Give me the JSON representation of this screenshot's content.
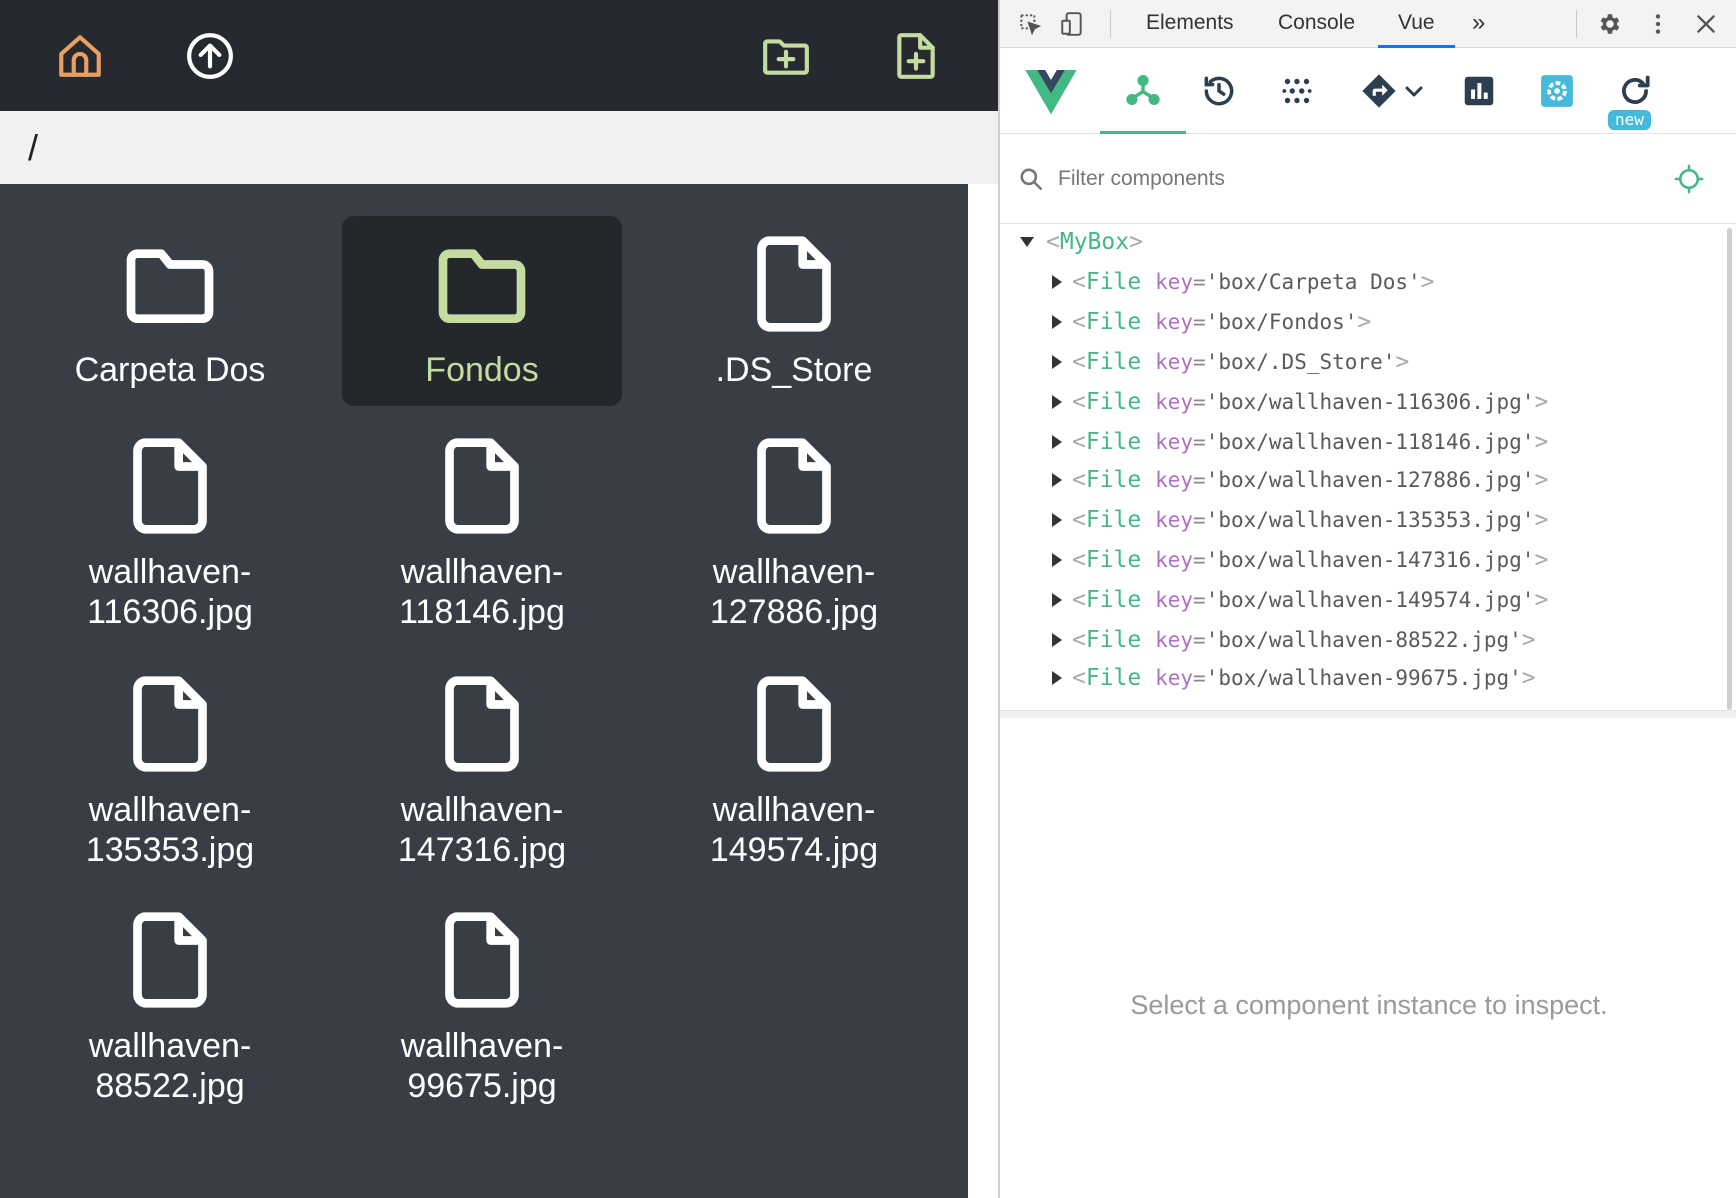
{
  "app": {
    "path": "/",
    "colors": {
      "toolbar_bg": "#262a30",
      "grid_bg": "#393e46",
      "home_icon": "#e8a062",
      "accent_green": "#c5dca0",
      "folder_normal": "#ffffff"
    },
    "toolbar": {
      "home_icon": "home-icon",
      "up_icon": "arrow-up-circle-icon",
      "new_folder_icon": "folder-plus-icon",
      "new_file_icon": "file-plus-icon"
    },
    "items": [
      {
        "name": "Carpeta Dos",
        "line1": "Carpeta Dos",
        "line2": "",
        "type": "folder",
        "selected": false
      },
      {
        "name": "Fondos",
        "line1": "Fondos",
        "line2": "",
        "type": "folder",
        "selected": true
      },
      {
        "name": ".DS_Store",
        "line1": ".DS_Store",
        "line2": "",
        "type": "file",
        "selected": false
      },
      {
        "name": "wallhaven-116306.jpg",
        "line1": "wallhaven-",
        "line2": "116306.jpg",
        "type": "file",
        "selected": false
      },
      {
        "name": "wallhaven-118146.jpg",
        "line1": "wallhaven-",
        "line2": "118146.jpg",
        "type": "file",
        "selected": false
      },
      {
        "name": "wallhaven-127886.jpg",
        "line1": "wallhaven-",
        "line2": "127886.jpg",
        "type": "file",
        "selected": false
      },
      {
        "name": "wallhaven-135353.jpg",
        "line1": "wallhaven-",
        "line2": "135353.jpg",
        "type": "file",
        "selected": false
      },
      {
        "name": "wallhaven-147316.jpg",
        "line1": "wallhaven-",
        "line2": "147316.jpg",
        "type": "file",
        "selected": false
      },
      {
        "name": "wallhaven-149574.jpg",
        "line1": "wallhaven-",
        "line2": "149574.jpg",
        "type": "file",
        "selected": false
      },
      {
        "name": "wallhaven-88522.jpg",
        "line1": "wallhaven-",
        "line2": "88522.jpg",
        "type": "file",
        "selected": false
      },
      {
        "name": "wallhaven-99675.jpg",
        "line1": "wallhaven-",
        "line2": "99675.jpg",
        "type": "file",
        "selected": false
      }
    ]
  },
  "devtools": {
    "tabs": {
      "elements": "Elements",
      "console": "Console",
      "vue": "Vue",
      "more": "»"
    },
    "active_tab": "Vue",
    "icons": {
      "inspect": "inspect-element-icon",
      "device": "device-toolbar-icon",
      "settings": "gear-icon",
      "kebab": "more-vert-icon",
      "close": "close-icon"
    },
    "vue": {
      "logo": "vue-logo-icon",
      "toolbar_icons": [
        "components-icon",
        "timeline-icon",
        "vuex-icon",
        "router-icon",
        "performance-icon",
        "settings-icon",
        "refresh-icon"
      ],
      "new_badge": "new",
      "accent": "#42b883",
      "filter_placeholder": "Filter components",
      "root": {
        "open": "<",
        "tag": "MyBox",
        "close": ">"
      },
      "components": [
        {
          "tag": "File",
          "attr": "key",
          "eq": "=",
          "value": "'box/Carpeta Dos'"
        },
        {
          "tag": "File",
          "attr": "key",
          "eq": "=",
          "value": "'box/Fondos'"
        },
        {
          "tag": "File",
          "attr": "key",
          "eq": "=",
          "value": "'box/.DS_Store'"
        },
        {
          "tag": "File",
          "attr": "key",
          "eq": "=",
          "value": "'box/wallhaven-116306.jpg'"
        },
        {
          "tag": "File",
          "attr": "key",
          "eq": "=",
          "value": "'box/wallhaven-118146.jpg'"
        },
        {
          "tag": "File",
          "attr": "key",
          "eq": "=",
          "value": "'box/wallhaven-127886.jpg'"
        },
        {
          "tag": "File",
          "attr": "key",
          "eq": "=",
          "value": "'box/wallhaven-135353.jpg'"
        },
        {
          "tag": "File",
          "attr": "key",
          "eq": "=",
          "value": "'box/wallhaven-147316.jpg'"
        },
        {
          "tag": "File",
          "attr": "key",
          "eq": "=",
          "value": "'box/wallhaven-149574.jpg'"
        },
        {
          "tag": "File",
          "attr": "key",
          "eq": "=",
          "value": "'box/wallhaven-88522.jpg'"
        },
        {
          "tag": "File",
          "attr": "key",
          "eq": "=",
          "value": "'box/wallhaven-99675.jpg'"
        }
      ],
      "empty_message": "Select a component instance to inspect."
    }
  }
}
